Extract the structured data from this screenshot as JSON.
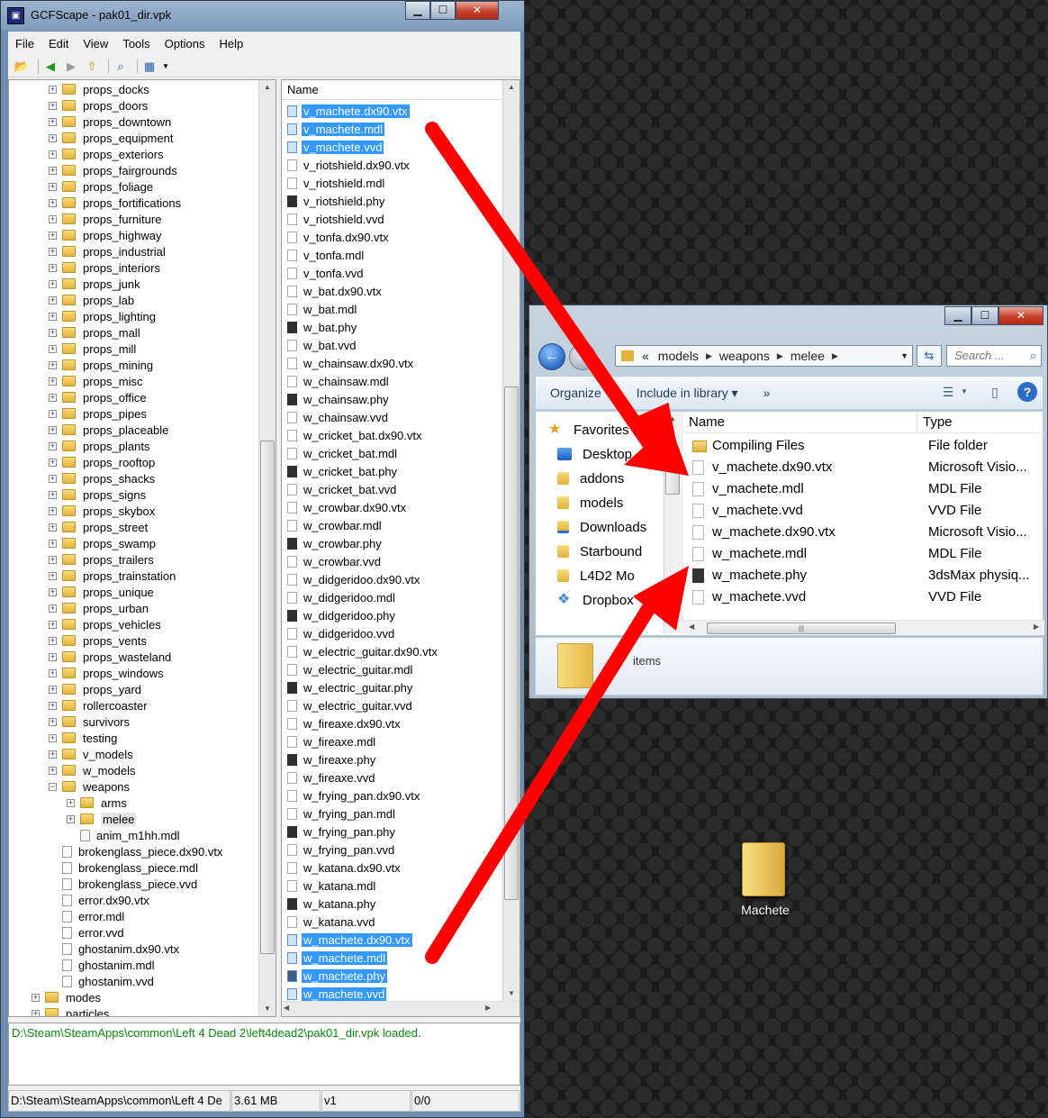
{
  "gcfscape": {
    "title": "GCFScape - pak01_dir.vpk",
    "menu": [
      "File",
      "Edit",
      "View",
      "Tools",
      "Options",
      "Help"
    ],
    "tree_folders": [
      "props_docks",
      "props_doors",
      "props_downtown",
      "props_equipment",
      "props_exteriors",
      "props_fairgrounds",
      "props_foliage",
      "props_fortifications",
      "props_furniture",
      "props_highway",
      "props_industrial",
      "props_interiors",
      "props_junk",
      "props_lab",
      "props_lighting",
      "props_mall",
      "props_mill",
      "props_mining",
      "props_misc",
      "props_office",
      "props_pipes",
      "props_placeable",
      "props_plants",
      "props_rooftop",
      "props_shacks",
      "props_signs",
      "props_skybox",
      "props_street",
      "props_swamp",
      "props_trailers",
      "props_trainstation",
      "props_unique",
      "props_urban",
      "props_vehicles",
      "props_vents",
      "props_wasteland",
      "props_windows",
      "props_yard",
      "rollercoaster",
      "survivors",
      "testing",
      "v_models",
      "w_models",
      "weapons"
    ],
    "weapons_children": [
      "arms",
      "melee"
    ],
    "weapons_files": [
      "anim_m1hh.mdl"
    ],
    "models_files": [
      "brokenglass_piece.dx90.vtx",
      "brokenglass_piece.mdl",
      "brokenglass_piece.vvd",
      "error.dx90.vtx",
      "error.mdl",
      "error.vvd",
      "ghostanim.dx90.vtx",
      "ghostanim.mdl",
      "ghostanim.vvd"
    ],
    "root_folders": [
      "modes",
      "particles"
    ],
    "list_header": "Name",
    "files": [
      {
        "name": "v_machete.dx90.vtx",
        "selected": true,
        "kind": "file"
      },
      {
        "name": "v_machete.mdl",
        "selected": true,
        "kind": "file"
      },
      {
        "name": "v_machete.vvd",
        "selected": true,
        "kind": "file"
      },
      {
        "name": "v_riotshield.dx90.vtx",
        "selected": false,
        "kind": "file"
      },
      {
        "name": "v_riotshield.mdl",
        "selected": false,
        "kind": "file"
      },
      {
        "name": "v_riotshield.phy",
        "selected": false,
        "kind": "phy"
      },
      {
        "name": "v_riotshield.vvd",
        "selected": false,
        "kind": "file"
      },
      {
        "name": "v_tonfa.dx90.vtx",
        "selected": false,
        "kind": "file"
      },
      {
        "name": "v_tonfa.mdl",
        "selected": false,
        "kind": "file"
      },
      {
        "name": "v_tonfa.vvd",
        "selected": false,
        "kind": "file"
      },
      {
        "name": "w_bat.dx90.vtx",
        "selected": false,
        "kind": "file"
      },
      {
        "name": "w_bat.mdl",
        "selected": false,
        "kind": "file"
      },
      {
        "name": "w_bat.phy",
        "selected": false,
        "kind": "phy"
      },
      {
        "name": "w_bat.vvd",
        "selected": false,
        "kind": "file"
      },
      {
        "name": "w_chainsaw.dx90.vtx",
        "selected": false,
        "kind": "file"
      },
      {
        "name": "w_chainsaw.mdl",
        "selected": false,
        "kind": "file"
      },
      {
        "name": "w_chainsaw.phy",
        "selected": false,
        "kind": "phy"
      },
      {
        "name": "w_chainsaw.vvd",
        "selected": false,
        "kind": "file"
      },
      {
        "name": "w_cricket_bat.dx90.vtx",
        "selected": false,
        "kind": "file"
      },
      {
        "name": "w_cricket_bat.mdl",
        "selected": false,
        "kind": "file"
      },
      {
        "name": "w_cricket_bat.phy",
        "selected": false,
        "kind": "phy"
      },
      {
        "name": "w_cricket_bat.vvd",
        "selected": false,
        "kind": "file"
      },
      {
        "name": "w_crowbar.dx90.vtx",
        "selected": false,
        "kind": "file"
      },
      {
        "name": "w_crowbar.mdl",
        "selected": false,
        "kind": "file"
      },
      {
        "name": "w_crowbar.phy",
        "selected": false,
        "kind": "phy"
      },
      {
        "name": "w_crowbar.vvd",
        "selected": false,
        "kind": "file"
      },
      {
        "name": "w_didgeridoo.dx90.vtx",
        "selected": false,
        "kind": "file"
      },
      {
        "name": "w_didgeridoo.mdl",
        "selected": false,
        "kind": "file"
      },
      {
        "name": "w_didgeridoo.phy",
        "selected": false,
        "kind": "phy"
      },
      {
        "name": "w_didgeridoo.vvd",
        "selected": false,
        "kind": "file"
      },
      {
        "name": "w_electric_guitar.dx90.vtx",
        "selected": false,
        "kind": "file"
      },
      {
        "name": "w_electric_guitar.mdl",
        "selected": false,
        "kind": "file"
      },
      {
        "name": "w_electric_guitar.phy",
        "selected": false,
        "kind": "phy"
      },
      {
        "name": "w_electric_guitar.vvd",
        "selected": false,
        "kind": "file"
      },
      {
        "name": "w_fireaxe.dx90.vtx",
        "selected": false,
        "kind": "file"
      },
      {
        "name": "w_fireaxe.mdl",
        "selected": false,
        "kind": "file"
      },
      {
        "name": "w_fireaxe.phy",
        "selected": false,
        "kind": "phy"
      },
      {
        "name": "w_fireaxe.vvd",
        "selected": false,
        "kind": "file"
      },
      {
        "name": "w_frying_pan.dx90.vtx",
        "selected": false,
        "kind": "file"
      },
      {
        "name": "w_frying_pan.mdl",
        "selected": false,
        "kind": "file"
      },
      {
        "name": "w_frying_pan.phy",
        "selected": false,
        "kind": "phy"
      },
      {
        "name": "w_frying_pan.vvd",
        "selected": false,
        "kind": "file"
      },
      {
        "name": "w_katana.dx90.vtx",
        "selected": false,
        "kind": "file"
      },
      {
        "name": "w_katana.mdl",
        "selected": false,
        "kind": "file"
      },
      {
        "name": "w_katana.phy",
        "selected": false,
        "kind": "phy"
      },
      {
        "name": "w_katana.vvd",
        "selected": false,
        "kind": "file"
      },
      {
        "name": "w_machete.dx90.vtx",
        "selected": true,
        "kind": "file"
      },
      {
        "name": "w_machete.mdl",
        "selected": true,
        "kind": "file"
      },
      {
        "name": "w_machete.phy",
        "selected": true,
        "kind": "phy"
      },
      {
        "name": "w_machete.vvd",
        "selected": true,
        "kind": "file"
      }
    ],
    "log_line": "D:\\Steam\\SteamApps\\common\\Left 4 Dead 2\\left4dead2\\pak01_dir.vpk loaded.",
    "status": {
      "path": "D:\\Steam\\SteamApps\\common\\Left 4 De",
      "size": "3.61 MB",
      "version": "v1",
      "count": "0/0"
    }
  },
  "explorer": {
    "breadcrumb": [
      "models",
      "weapons",
      "melee"
    ],
    "breadcrumb_prefix": "«",
    "search_placeholder": "Search ...",
    "organize_label": "Organize",
    "include_label": "Include in library",
    "more_label": "»",
    "nav_items": [
      {
        "label": "Favorites",
        "icon": "star"
      },
      {
        "label": "Desktop",
        "icon": "desk"
      },
      {
        "label": "addons",
        "icon": "fold"
      },
      {
        "label": "models",
        "icon": "fold"
      },
      {
        "label": "Downloads",
        "icon": "dl"
      },
      {
        "label": "Starbound",
        "icon": "fold"
      },
      {
        "label": "L4D2 Mo",
        "icon": "fold"
      },
      {
        "label": "Dropbox",
        "icon": "drop"
      }
    ],
    "col_name": "Name",
    "col_type": "Type",
    "files": [
      {
        "name": "Compiling Files",
        "type": "File folder",
        "kind": "folder"
      },
      {
        "name": "v_machete.dx90.vtx",
        "type": "Microsoft Visio...",
        "kind": "file"
      },
      {
        "name": "v_machete.mdl",
        "type": "MDL File",
        "kind": "file"
      },
      {
        "name": "v_machete.vvd",
        "type": "VVD File",
        "kind": "file"
      },
      {
        "name": "w_machete.dx90.vtx",
        "type": "Microsoft Visio...",
        "kind": "file"
      },
      {
        "name": "w_machete.mdl",
        "type": "MDL File",
        "kind": "file"
      },
      {
        "name": "w_machete.phy",
        "type": "3dsMax physiq...",
        "kind": "phy"
      },
      {
        "name": "w_machete.vvd",
        "type": "VVD File",
        "kind": "file"
      }
    ],
    "details_text": "items"
  },
  "desktop": {
    "icon_label": "Machete"
  },
  "colors": {
    "selection": "#3399ff",
    "arrow": "#ff0000",
    "log_text": "#0b8a0b"
  }
}
